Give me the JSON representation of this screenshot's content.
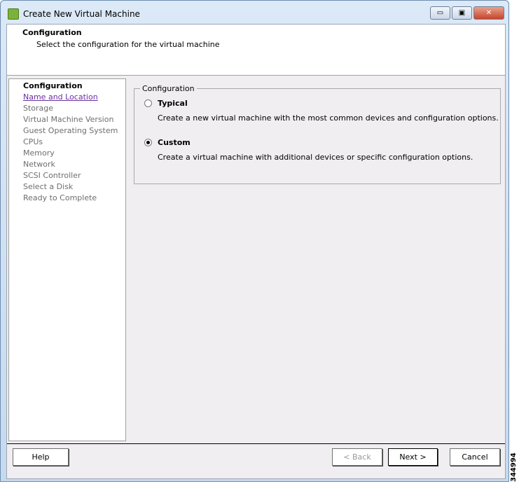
{
  "window": {
    "title": "Create New Virtual Machine",
    "minimize": "▭",
    "maximize": "▣",
    "close": "✕"
  },
  "header": {
    "title": "Configuration",
    "subtitle": "Select the configuration for the virtual machine"
  },
  "sidebar": {
    "items": [
      {
        "label": "Configuration",
        "state": "current"
      },
      {
        "label": "Name and Location",
        "state": "link"
      },
      {
        "label": "Storage",
        "state": "disabled"
      },
      {
        "label": "Virtual Machine Version",
        "state": "disabled"
      },
      {
        "label": "Guest Operating System",
        "state": "disabled"
      },
      {
        "label": "CPUs",
        "state": "disabled"
      },
      {
        "label": "Memory",
        "state": "disabled"
      },
      {
        "label": "Network",
        "state": "disabled"
      },
      {
        "label": "SCSI Controller",
        "state": "disabled"
      },
      {
        "label": "Select a Disk",
        "state": "disabled"
      },
      {
        "label": "Ready to Complete",
        "state": "disabled"
      }
    ]
  },
  "config": {
    "legend": "Configuration",
    "options": [
      {
        "label": "Typical",
        "desc": "Create a new virtual machine with the most common devices and configuration options.",
        "selected": false
      },
      {
        "label": "Custom",
        "desc": "Create a virtual machine with additional devices or specific configuration options.",
        "selected": true
      }
    ]
  },
  "buttons": {
    "help": "Help",
    "back": "< Back",
    "next": "Next >",
    "cancel": "Cancel"
  },
  "watermark": "344994"
}
